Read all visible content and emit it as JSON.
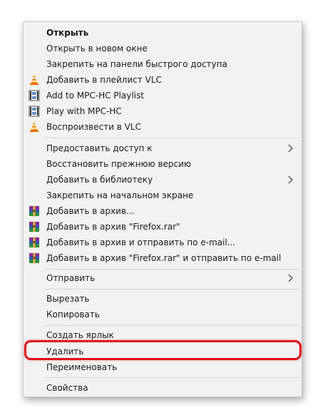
{
  "menu": {
    "open": "Открыть",
    "open_new_window": "Открыть в новом окне",
    "pin_quick_access": "Закрепить на панели быстрого доступа",
    "vlc_add_playlist": "Добавить в плейлист VLC",
    "mpc_add_playlist": "Add to MPC-HC Playlist",
    "mpc_play": "Play with MPC-HC",
    "vlc_play": "Воспроизвести в VLC",
    "give_access": "Предоставить доступ к",
    "restore_version": "Восстановить прежнюю версию",
    "add_library": "Добавить в библиотеку",
    "pin_start": "Закрепить на начальном экране",
    "archive_add": "Добавить в архив...",
    "archive_add_named": "Добавить в архив \"Firefox.rar\"",
    "archive_email": "Добавить в архив и отправить по e-mail...",
    "archive_named_email": "Добавить в архив \"Firefox.rar\" и отправить по e-mail",
    "send_to": "Отправить",
    "cut": "Вырезать",
    "copy": "Копировать",
    "create_shortcut": "Создать ярлык",
    "delete": "Удалить",
    "rename": "Переименовать",
    "properties": "Свойства"
  },
  "icons": {
    "vlc": "vlc-cone-icon",
    "mpc": "mpc-hc-icon",
    "winrar": "winrar-icon",
    "submenu": "chevron-right-icon"
  },
  "colors": {
    "highlight": "#e3101a",
    "vlc_orange": "#f08a00"
  }
}
